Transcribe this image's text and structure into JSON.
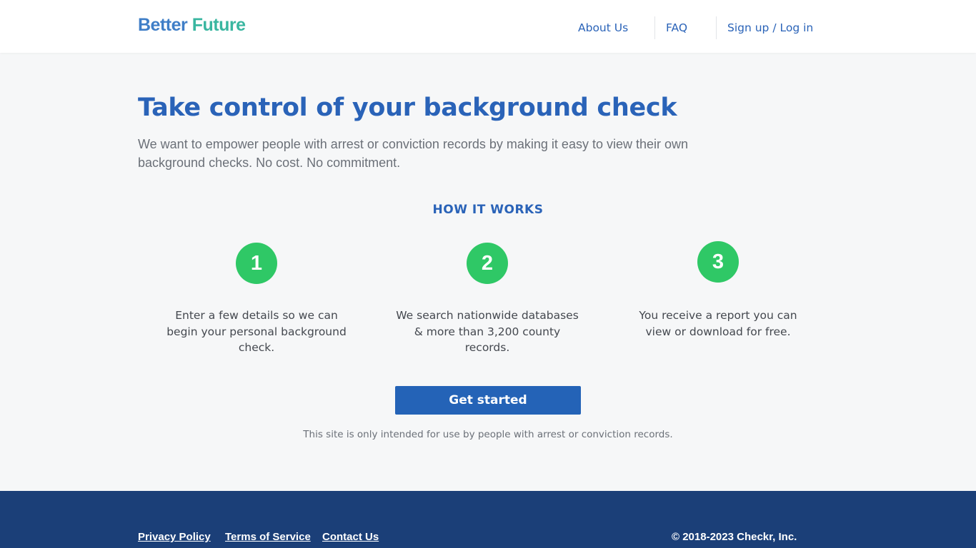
{
  "header": {
    "logo_part1": "Better",
    "logo_part2": "Future",
    "nav": {
      "about": "About Us",
      "faq": "FAQ",
      "signup": "Sign up / Log in"
    }
  },
  "hero": {
    "title": "Take control of your background check",
    "subtitle": "We want to empower people with arrest or conviction records by making it easy to view their own background checks. No cost. No commitment."
  },
  "how_it_works": {
    "heading": "HOW IT WORKS",
    "steps": [
      {
        "number": "1",
        "text": "Enter a few details so we can begin your personal background check."
      },
      {
        "number": "2",
        "text": "We search nationwide databases & more than 3,200 county records."
      },
      {
        "number": "3",
        "text": "You receive a report you can view or download for free."
      }
    ]
  },
  "cta": {
    "label": "Get started",
    "disclaimer": "This site is only intended for use by people with arrest or conviction records."
  },
  "footer": {
    "links": {
      "privacy": "Privacy Policy",
      "terms": "Terms of Service",
      "contact": "Contact Us"
    },
    "copyright": "© 2018-2023 Checkr, Inc."
  },
  "colors": {
    "brand_blue": "#2a63b8",
    "logo_teal": "#39b6a0",
    "step_green": "#2fc866",
    "button_blue": "#2463b7",
    "footer_navy": "#1b3f78"
  }
}
